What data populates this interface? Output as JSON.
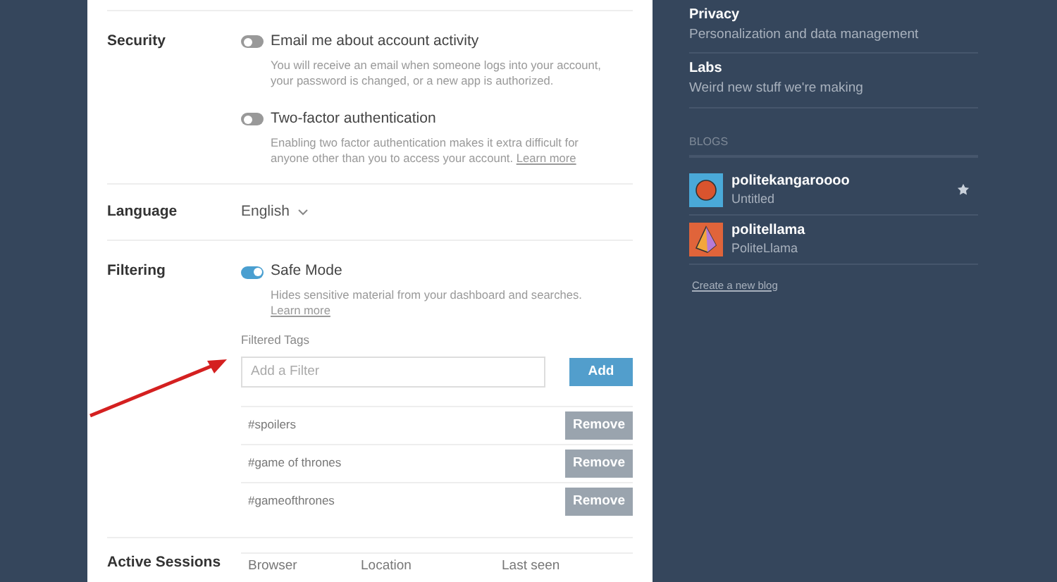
{
  "settings": {
    "sections": [
      {
        "label": "Security",
        "kind": "toggles",
        "toggles": [
          {
            "title": "Email me about account activity",
            "description": "You will receive an email when someone logs into your account, your password is changed, or a new app is authorized.",
            "on": false
          },
          {
            "title": "Two-factor authentication",
            "description": "Enabling two factor authentication makes it extra difficult for anyone other than you to access your account.",
            "link": "Learn more",
            "on": false
          }
        ]
      },
      {
        "label": "Language",
        "kind": "select",
        "value": "English"
      },
      {
        "label": "Filtering",
        "kind": "filtering",
        "toggles": [
          {
            "title": "Safe Mode",
            "description": "Hides sensitive material from your dashboard and searches.",
            "link": "Learn more",
            "on": true
          }
        ],
        "filtered_tags": {
          "heading": "Filtered Tags",
          "input": {
            "placeholder": "Add a Filter"
          },
          "add_button": "Add",
          "tags": [
            {
              "tag": "#spoilers",
              "button": "Remove"
            },
            {
              "tag": "#game of thrones",
              "button": "Remove"
            },
            {
              "tag": "#gameofthrones",
              "button": "Remove"
            }
          ]
        }
      },
      {
        "label": "Active Sessions",
        "kind": "sessions",
        "columns": [
          "Browser",
          "Location",
          "Last seen"
        ]
      }
    ]
  },
  "sidebar": {
    "items": [
      {
        "title": "Privacy",
        "subtitle": "Personalization and data management"
      },
      {
        "title": "Labs",
        "subtitle": "Weird new stuff we're making"
      }
    ],
    "blogs_heading": "BLOGS",
    "blogs": [
      {
        "name": "politekangaroooo",
        "title": "Untitled",
        "color": "#4aa9d8",
        "starred": true
      },
      {
        "name": "politellama",
        "title": "PoliteLlama",
        "color": "#e0643a",
        "starred": false
      }
    ],
    "create_link": "Create a new blog"
  }
}
